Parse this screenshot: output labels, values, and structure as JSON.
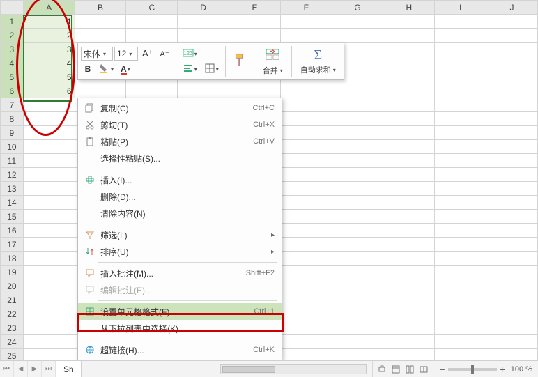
{
  "columns": [
    "A",
    "B",
    "C",
    "D",
    "E",
    "F",
    "G",
    "H",
    "I",
    "J"
  ],
  "rows": [
    "1",
    "2",
    "3",
    "4",
    "5",
    "6",
    "7",
    "8",
    "9",
    "10",
    "11",
    "12",
    "13",
    "14",
    "15",
    "16",
    "17",
    "18",
    "19",
    "20",
    "21",
    "22",
    "23",
    "24",
    "25"
  ],
  "cells_colA": [
    "1",
    "2",
    "3",
    "4",
    "5",
    "6"
  ],
  "selected_rows": [
    0,
    1,
    2,
    3,
    4,
    5
  ],
  "mini_toolbar": {
    "font_name": "宋体",
    "font_size": "12",
    "merge_label": "合并",
    "autosum_label": "自动求和"
  },
  "context_menu": {
    "copy": "复制(C)",
    "copy_sc": "Ctrl+C",
    "cut": "剪切(T)",
    "cut_sc": "Ctrl+X",
    "paste": "粘贴(P)",
    "paste_sc": "Ctrl+V",
    "paste_special": "选择性粘贴(S)...",
    "insert": "插入(I)...",
    "delete": "删除(D)...",
    "clear": "清除内容(N)",
    "filter": "筛选(L)",
    "sort": "排序(U)",
    "insert_comment": "插入批注(M)...",
    "insert_comment_sc": "Shift+F2",
    "edit_comment": "编辑批注(E)...",
    "format_cells": "设置单元格格式(F)...",
    "format_cells_sc": "Ctrl+1",
    "pick_list": "从下拉列表中选择(K)...",
    "hyperlink": "超链接(H)...",
    "hyperlink_sc": "Ctrl+K"
  },
  "statusbar": {
    "sheet_tab": "Sh",
    "zoom_label": "100 %"
  }
}
